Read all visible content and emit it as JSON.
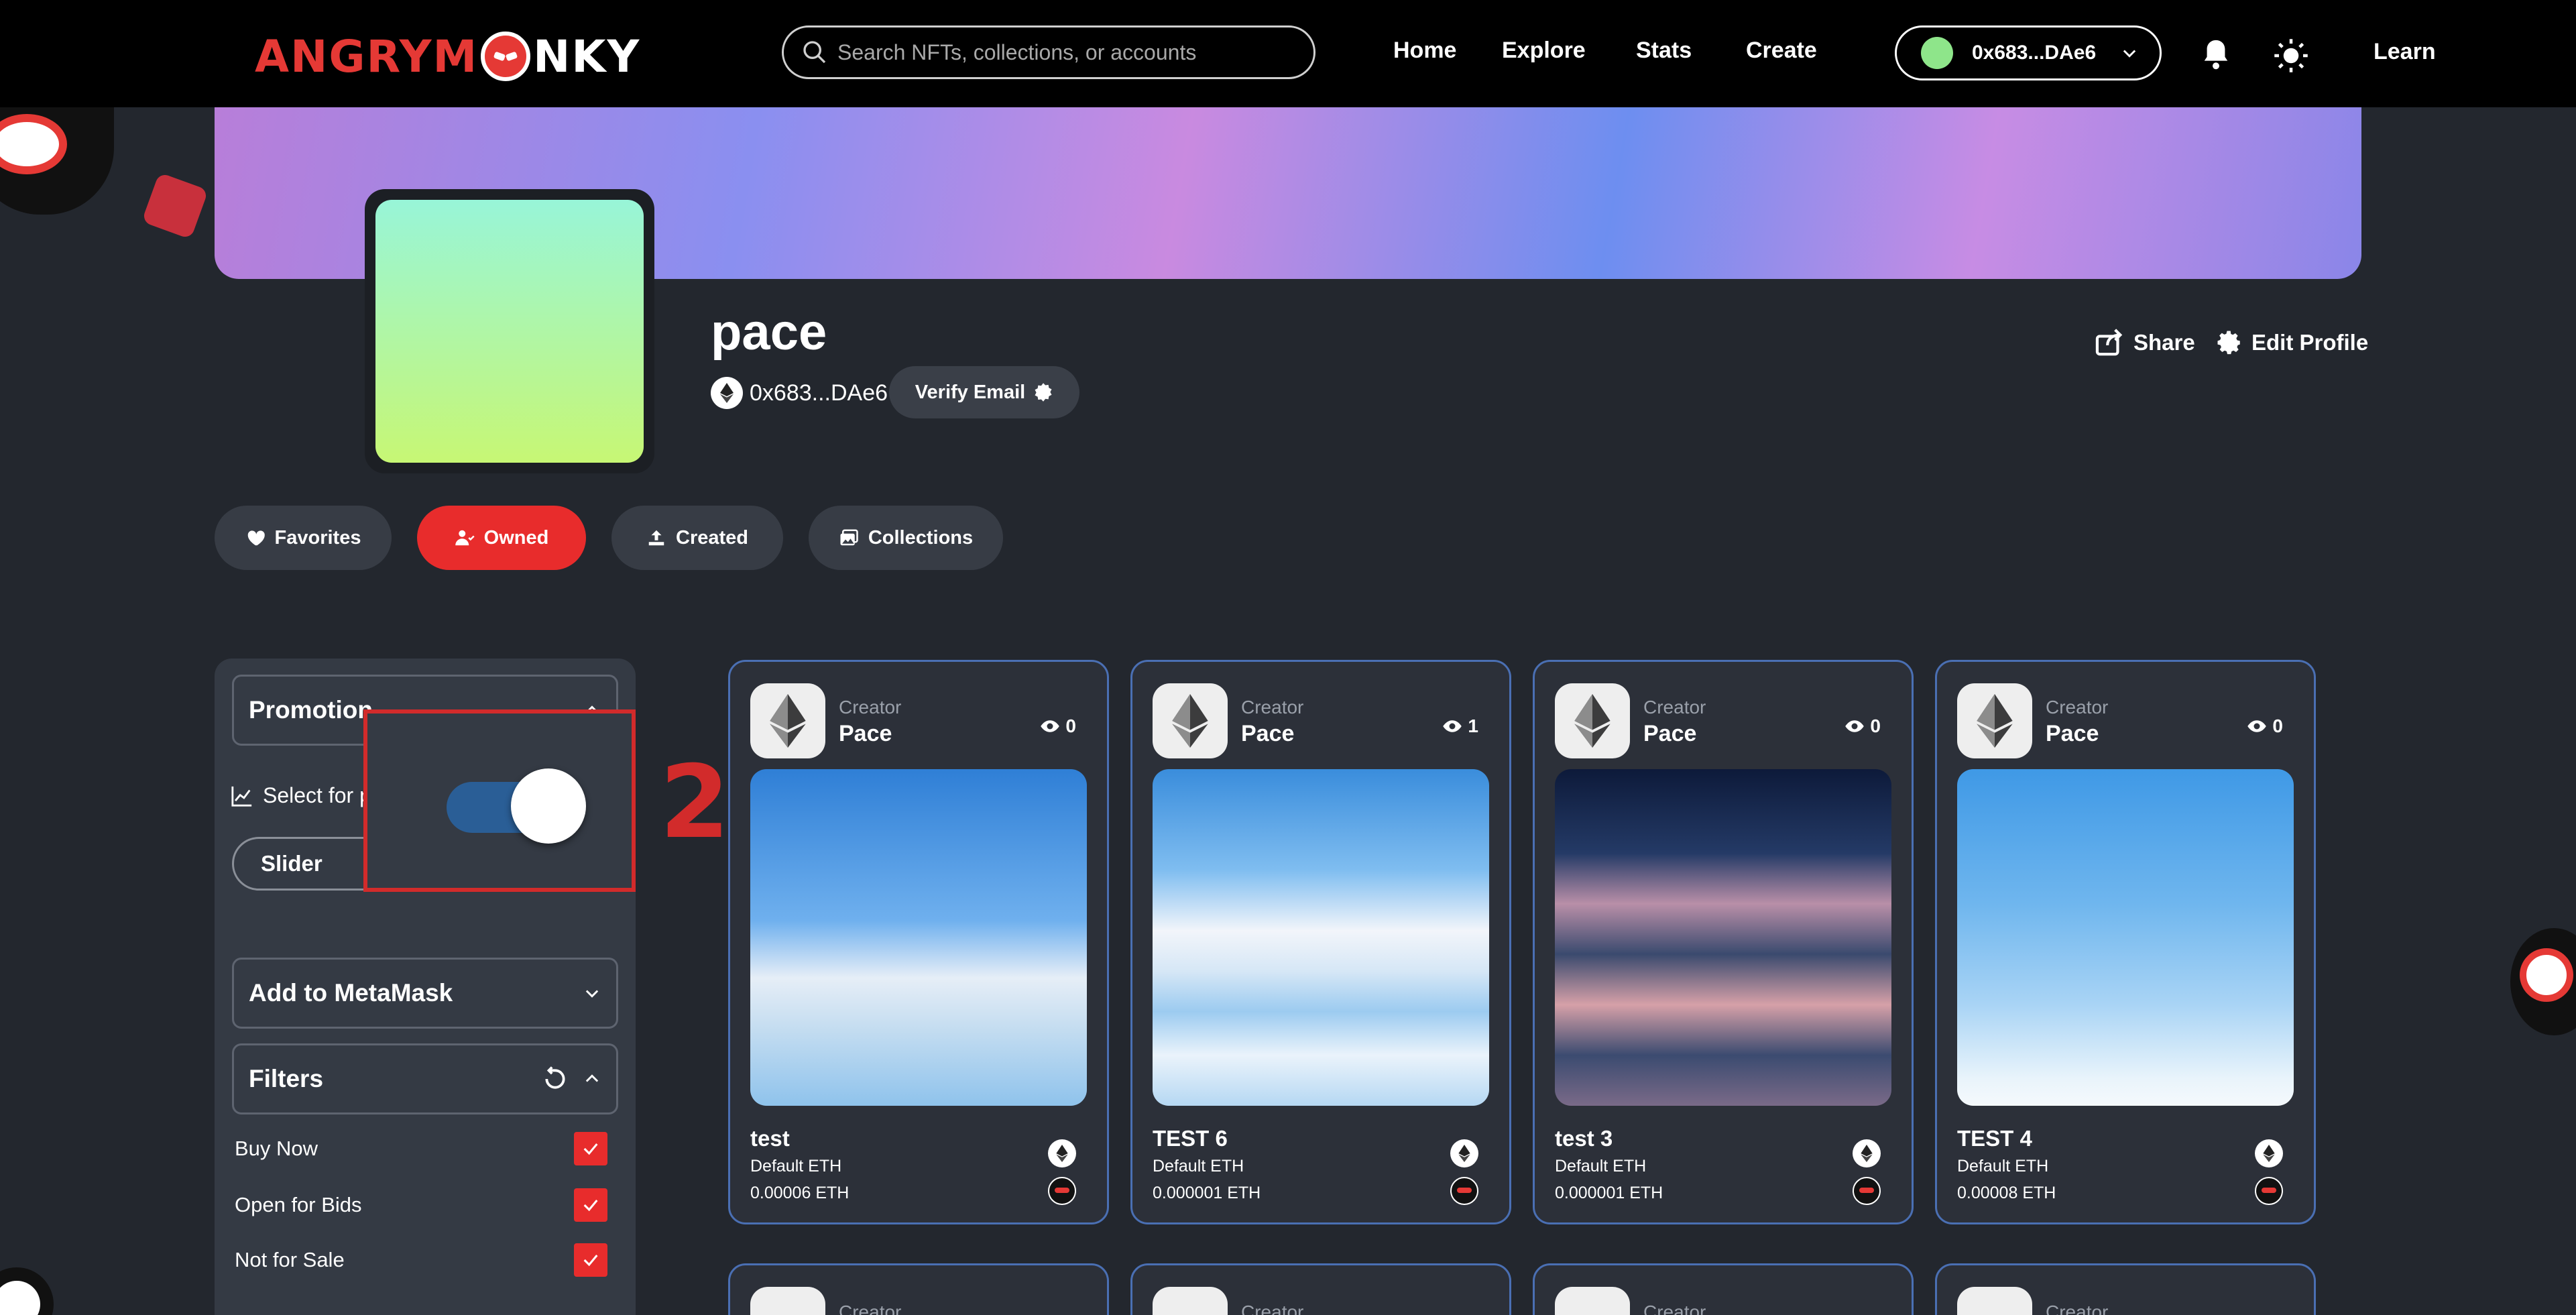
{
  "logo": {
    "prefix": "ANGRYM",
    "suffix": "NKY"
  },
  "search": {
    "placeholder": "Search NFTs, collections, or accounts"
  },
  "nav": {
    "home": "Home",
    "explore": "Explore",
    "stats": "Stats",
    "create": "Create",
    "learn": "Learn"
  },
  "wallet": {
    "address": "0x683...DAe6"
  },
  "profile": {
    "username": "pace",
    "address": "0x683...DAe6",
    "verify_email": "Verify Email",
    "share": "Share",
    "edit_profile": "Edit Profile"
  },
  "tabs": [
    {
      "label": "Favorites",
      "active": false
    },
    {
      "label": "Owned",
      "active": true
    },
    {
      "label": "Created",
      "active": false
    },
    {
      "label": "Collections",
      "active": false
    }
  ],
  "sidebar": {
    "promotion_title": "Promotion",
    "select_for_label": "Select for p",
    "slider_label": "Slider",
    "metamask_title": "Add to MetaMask",
    "filters_title": "Filters",
    "filters": [
      {
        "label": "Buy Now",
        "checked": true
      },
      {
        "label": "Open for Bids",
        "checked": true
      },
      {
        "label": "Not for Sale",
        "checked": true
      }
    ]
  },
  "toggle": {
    "on": true
  },
  "annotation": {
    "step": "2"
  },
  "cards": [
    {
      "creator_label": "Creator",
      "creator": "Pace",
      "views": "0",
      "title": "test",
      "currency": "Default ETH",
      "price": "0.00006  ETH",
      "image": "clouds-sea"
    },
    {
      "creator_label": "Creator",
      "creator": "Pace",
      "views": "1",
      "title": "TEST 6",
      "currency": "Default ETH",
      "price": "0.000001  ETH",
      "image": "cloud-reflection"
    },
    {
      "creator_label": "Creator",
      "creator": "Pace",
      "views": "0",
      "title": "test 3",
      "currency": "Default ETH",
      "price": "0.000001  ETH",
      "image": "earth-clouds"
    },
    {
      "creator_label": "Creator",
      "creator": "Pace",
      "views": "0",
      "title": "TEST 4",
      "currency": "Default ETH",
      "price": "0.00008  ETH",
      "image": "floating-clouds"
    }
  ],
  "cards_row2": [
    {
      "creator_label": "Creator"
    },
    {
      "creator_label": "Creator"
    },
    {
      "creator_label": "Creator"
    },
    {
      "creator_label": "Creator"
    }
  ],
  "colors": {
    "accent": "#e82c2c",
    "card_border": "#4a6fb3",
    "panel": "#343a44",
    "bg": "#23272e"
  }
}
